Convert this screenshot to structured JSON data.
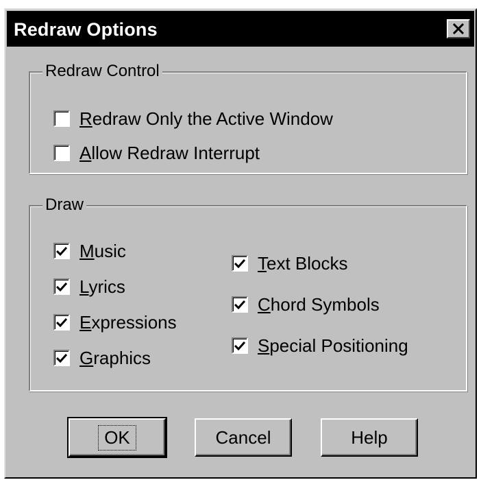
{
  "dialog": {
    "title": "Redraw Options",
    "close_label": "×"
  },
  "redraw_control": {
    "label": "Redraw Control",
    "options": [
      {
        "first": "R",
        "rest": "edraw Only the Active Window",
        "checked": false
      },
      {
        "first": "A",
        "rest": "llow Redraw Interrupt",
        "checked": false
      }
    ]
  },
  "draw": {
    "label": "Draw",
    "left": [
      {
        "first": "M",
        "rest": "usic",
        "checked": true
      },
      {
        "first": "L",
        "rest": "yrics",
        "checked": true
      },
      {
        "first": "E",
        "rest": "xpressions",
        "checked": true
      },
      {
        "first": "G",
        "rest": "raphics",
        "checked": true
      }
    ],
    "right": [
      {
        "first": "T",
        "rest": "ext Blocks",
        "checked": true
      },
      {
        "first": "C",
        "rest": "hord Symbols",
        "checked": true
      },
      {
        "first": "S",
        "rest": "pecial Positioning",
        "checked": true
      }
    ]
  },
  "buttons": {
    "ok": "OK",
    "cancel": "Cancel",
    "help": "Help"
  },
  "colors": {
    "dialog_bg": "#c0c0c0",
    "titlebar": "#000000"
  }
}
